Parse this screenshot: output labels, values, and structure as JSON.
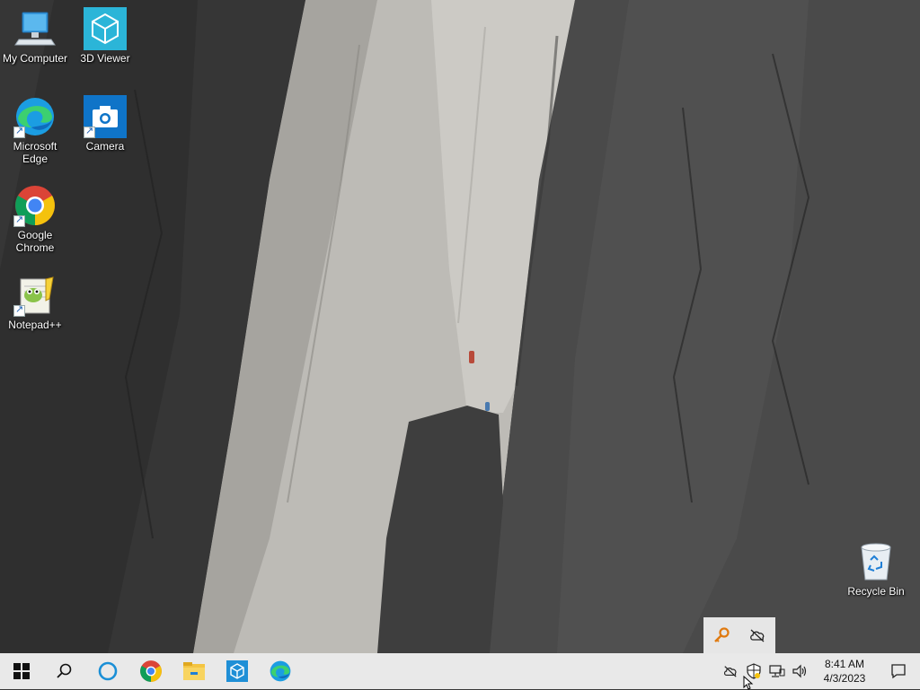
{
  "desktop": {
    "icons": [
      {
        "label": "My Computer",
        "icon": "computer-icon"
      },
      {
        "label": "3D Viewer",
        "icon": "3d-viewer-icon"
      },
      {
        "label": "Microsoft Edge",
        "icon": "edge-icon"
      },
      {
        "label": "Camera",
        "icon": "camera-icon"
      },
      {
        "label": "Google Chrome",
        "icon": "chrome-icon"
      },
      {
        "label": "Notepad++",
        "icon": "notepadpp-icon"
      },
      {
        "label": "Recycle Bin",
        "icon": "recycle-bin-icon"
      }
    ]
  },
  "tray_popup": {
    "items": [
      "key-icon",
      "cloud-off-icon"
    ]
  },
  "taskbar": {
    "pinned": [
      "start-icon",
      "search-icon",
      "cortana-icon",
      "chrome-icon",
      "file-explorer-icon",
      "3d-viewer-icon",
      "edge-icon"
    ],
    "tray": [
      "cloud-off-icon",
      "security-shield-icon",
      "network-icon",
      "volume-icon"
    ],
    "clock": {
      "time": "8:41 AM",
      "date": "4/3/2023"
    }
  },
  "colors": {
    "taskbar_bg": "#e9e9e9",
    "accent_blue": "#0078d4",
    "icon_label": "#ffffff"
  }
}
